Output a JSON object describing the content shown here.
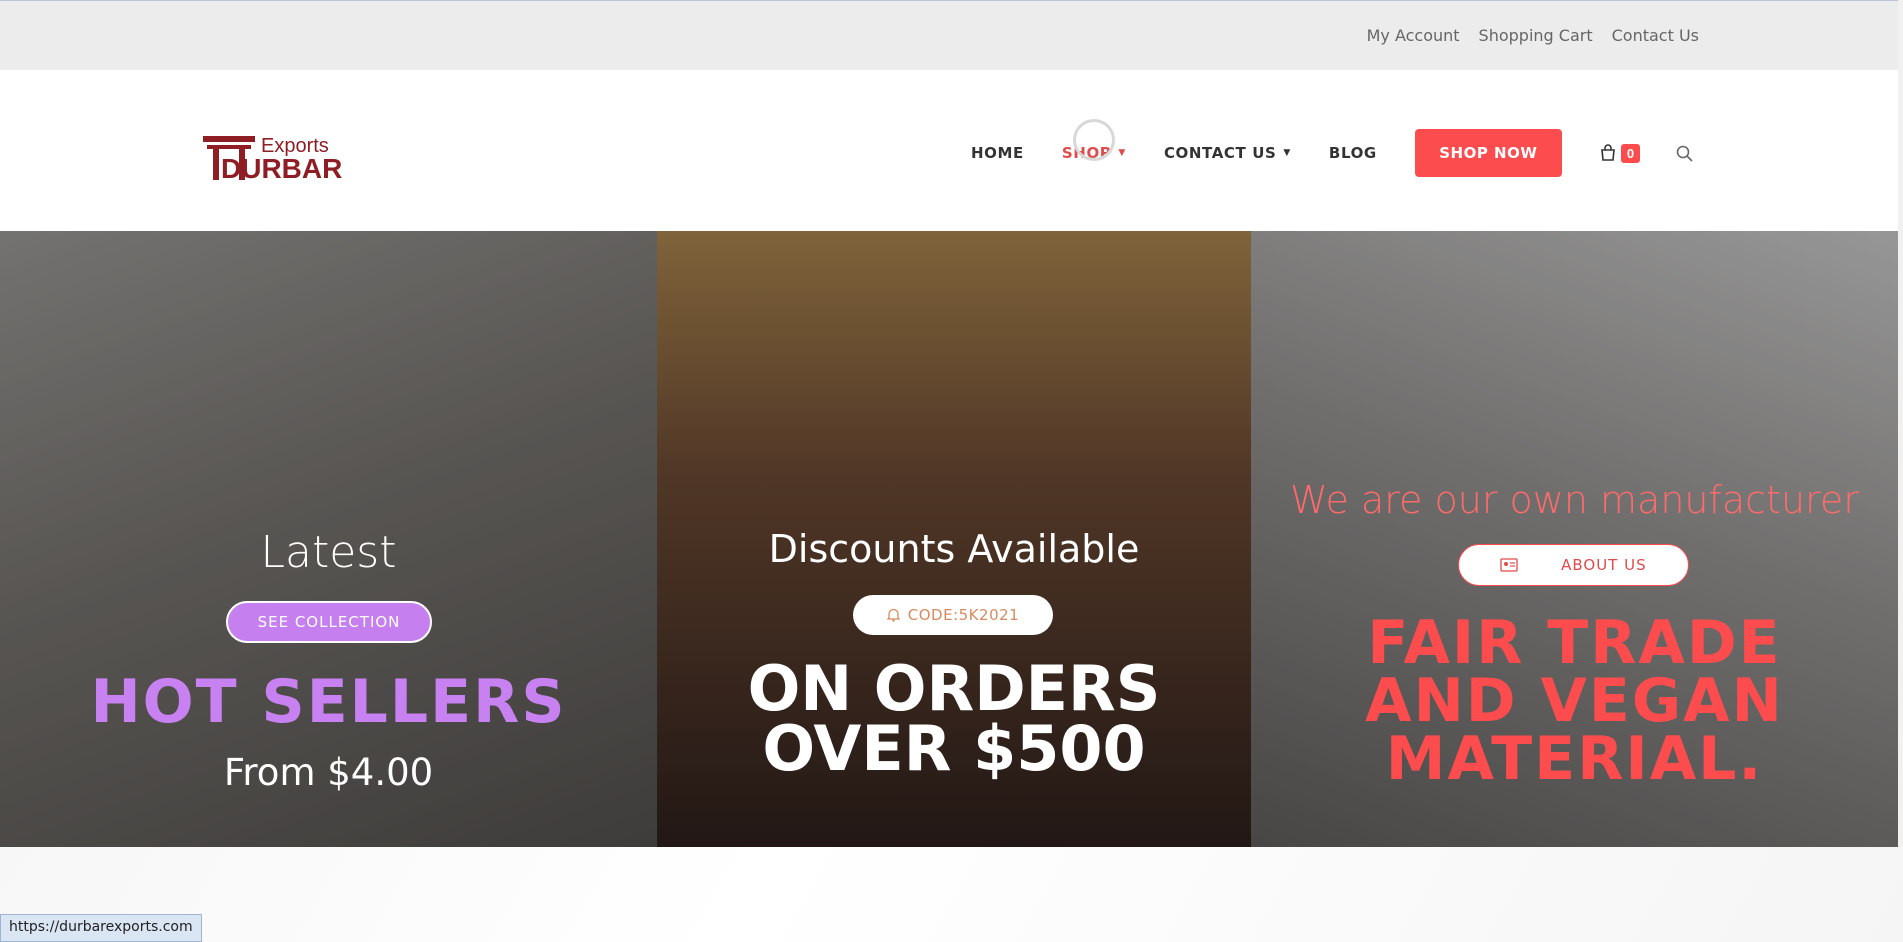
{
  "topbar": {
    "links": [
      "My Account",
      "Shopping Cart",
      "Contact Us"
    ]
  },
  "logo": {
    "text_top": "Exports",
    "text_main": "DURBAR"
  },
  "nav": {
    "items": [
      {
        "label": "HOME"
      },
      {
        "label": "SHOP"
      },
      {
        "label": "CONTACT US"
      },
      {
        "label": "BLOG"
      }
    ],
    "shop_now": "SHOP NOW",
    "cart_count": "0"
  },
  "hero": {
    "panel1": {
      "heading": "Latest",
      "button": "SEE COLLECTION",
      "headline": "HOT SELLERS",
      "price": "From $4.00"
    },
    "panel2": {
      "heading": "Discounts Available",
      "button": "CODE:5K2021",
      "headline_line1": "ON ORDERS",
      "headline_line2": "OVER $500"
    },
    "panel3": {
      "heading": "We are our own manufacturer",
      "button": "ABOUT US",
      "headline_line1": "FAIR TRADE",
      "headline_line2": "AND VEGAN",
      "headline_line3": "MATERIAL."
    }
  },
  "status_url": "https://durbarexports.com",
  "colors": {
    "accent": "#fc4c4e",
    "purple": "#c57fef"
  }
}
